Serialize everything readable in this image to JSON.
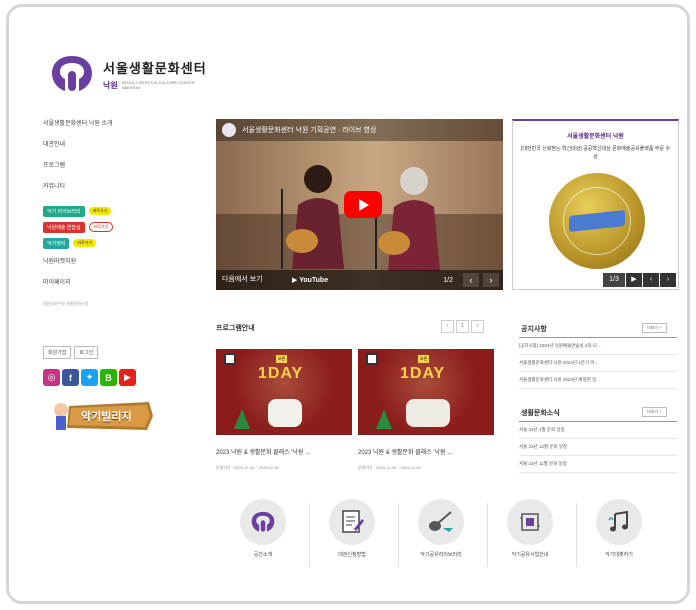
{
  "header": {
    "title": "서울생활문화센터",
    "subtitle": "낙원",
    "english": "SEOUL LIFESTYLE CULTURE CENTER NAKWON"
  },
  "sidebar": {
    "items": [
      {
        "label": "서울생활문화센터 낙원 소개"
      },
      {
        "label": "대관안내"
      },
      {
        "label": "프로그램"
      },
      {
        "label": "커뮤니티"
      }
    ],
    "tags": [
      {
        "label": "악기 라이브러리",
        "badge": "바로가기",
        "color": "#23a98a"
      },
      {
        "label": "낙원예술 연습실",
        "badge": "바로가기",
        "color": "#d9322f"
      },
      {
        "label": "악기정비",
        "badge": "바로가기",
        "color": "#1fa7a0"
      }
    ],
    "more_items": [
      {
        "label": "낙원마켓지원"
      },
      {
        "label": "마이페이지"
      },
      {
        "label": "회원정보수정 회원탈퇴신청"
      }
    ],
    "mini_links": [
      "회원가입",
      "로그인"
    ],
    "social": [
      {
        "icon": "instagram-icon",
        "glyph": "◎",
        "color": "#c13584"
      },
      {
        "icon": "facebook-icon",
        "glyph": "f",
        "color": "#3b5998"
      },
      {
        "icon": "twitter-icon",
        "glyph": "✦",
        "color": "#1da1f2"
      },
      {
        "icon": "blog-icon",
        "glyph": "B",
        "color": "#2db400"
      },
      {
        "icon": "youtube-icon",
        "glyph": "▶",
        "color": "#e62117"
      }
    ],
    "banner_label": "악기빌리지"
  },
  "video": {
    "title": "서울생활문화센터 낙원 기획공연 · 라이브 영상",
    "watch_label": "다음에서 보기",
    "yt_label": "▶ YouTube",
    "counter": "1/2"
  },
  "award": {
    "title": "서울생활문화센터 낙원",
    "desc": "[대한민국 신뢰받는 혁신대상] 공공혁신대상 문화예술공유플랫폼 부문 수상",
    "counter": "1/3"
  },
  "program": {
    "title": "프로그램안내",
    "pager": [
      "‹",
      "1",
      "›"
    ],
    "cards": [
      {
        "badge": "오픈",
        "banner": "1DAY",
        "title": "2023 낙원 & 생활문화 클래스 '낙원 ...",
        "date": "운영기간 : 2023.12.16 ~ 2023.12.16"
      },
      {
        "badge": "오픈",
        "banner": "1DAY",
        "title": "2023 낙원 & 생활문화 클래스 '낙원 ...",
        "date": "운영기간 : 2023.12.09 ~ 2023.12.09"
      }
    ]
  },
  "notice": {
    "title": "공지사항",
    "more": "더보기 +",
    "items": [
      "[공지사항] 2024년 낙원예술연습실 2차 모...",
      "서울생활문화센터 낙원 2024년 1분기 이...",
      "서울생활문화센터 낙원 2023년 예정된 일..."
    ]
  },
  "news": {
    "title": "생활문화소식",
    "more": "더보기 +",
    "items": [
      "서울 24년 1월 문화 일정",
      "서울 23년 12월 문화 일정",
      "서울 23년 11월 문화 일정"
    ]
  },
  "quick_menu": [
    {
      "label": "공간소개",
      "icon": "logo-icon"
    },
    {
      "label": "대관신청방법",
      "icon": "document-icon"
    },
    {
      "label": "악기공유라이브러리",
      "icon": "guitar-icon"
    },
    {
      "label": "악기공유사업안내",
      "icon": "music-box-icon"
    },
    {
      "label": "악기대출하기",
      "icon": "music-note-icon"
    }
  ]
}
